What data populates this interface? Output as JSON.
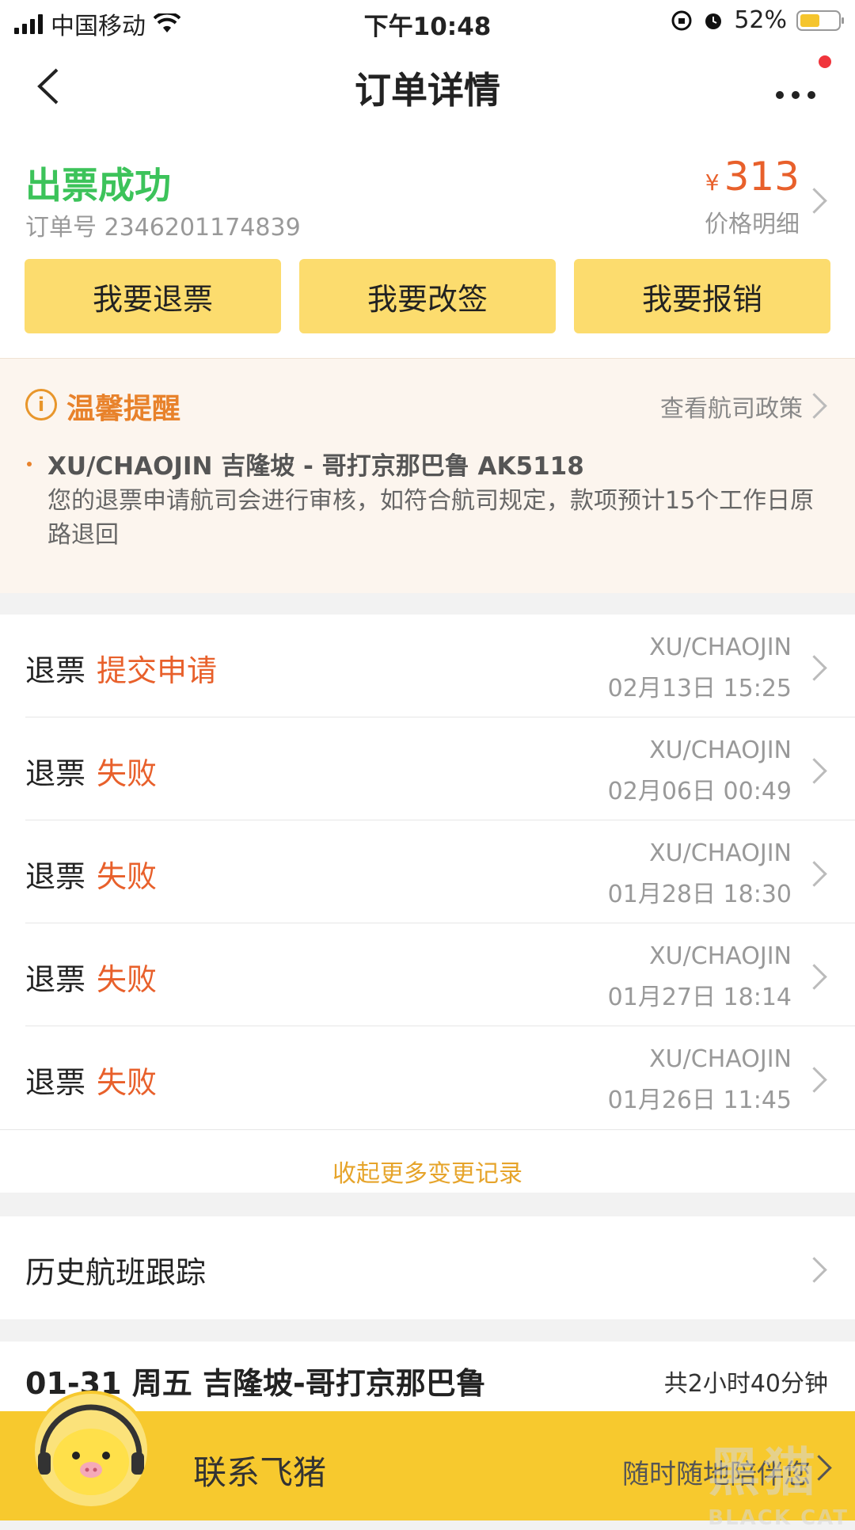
{
  "status_bar": {
    "carrier": "中国移动",
    "time": "下午10:48",
    "battery_percent": "52%",
    "battery_level": 0.52
  },
  "nav": {
    "title": "订单详情"
  },
  "order": {
    "status": "出票成功",
    "order_no": "订单号 2346201174839",
    "currency": "¥",
    "price": "313",
    "price_detail": "价格明细",
    "buttons": [
      "我要退票",
      "我要改签",
      "我要报销"
    ]
  },
  "notice": {
    "title": "温馨提醒",
    "policy_link": "查看航司政策",
    "flight": "XU/CHAOJIN 吉隆坡 - 哥打京那巴鲁 AK5118",
    "text": "您的退票申请航司会进行审核，如符合航司规定，款项预计15个工作日原路退回"
  },
  "records": [
    {
      "label": "退票",
      "status": "提交申请",
      "name": "XU/CHAOJIN",
      "time": "02月13日 15:25"
    },
    {
      "label": "退票",
      "status": "失败",
      "name": "XU/CHAOJIN",
      "time": "02月06日 00:49"
    },
    {
      "label": "退票",
      "status": "失败",
      "name": "XU/CHAOJIN",
      "time": "01月28日 18:30"
    },
    {
      "label": "退票",
      "status": "失败",
      "name": "XU/CHAOJIN",
      "time": "01月27日 18:14"
    },
    {
      "label": "退票",
      "status": "失败",
      "name": "XU/CHAOJIN",
      "time": "01月26日 11:45"
    }
  ],
  "collapse_label": "收起更多变更记录",
  "history_label": "历史航班跟踪",
  "flight": {
    "summary": "01-31 周五 吉隆坡-哥打京那巴鲁",
    "duration": "共2小时40分钟"
  },
  "bottom": {
    "contact": "联系飞猪",
    "slogan": "随时随地陪伴您"
  },
  "watermark": {
    "cn": "黑猫",
    "en": "BLACK CAT"
  },
  "colors": {
    "success": "#3cc35a",
    "accent_orange": "#e8602b",
    "button_yellow": "#fcdc6e",
    "bottom_yellow": "#f7c92e"
  }
}
